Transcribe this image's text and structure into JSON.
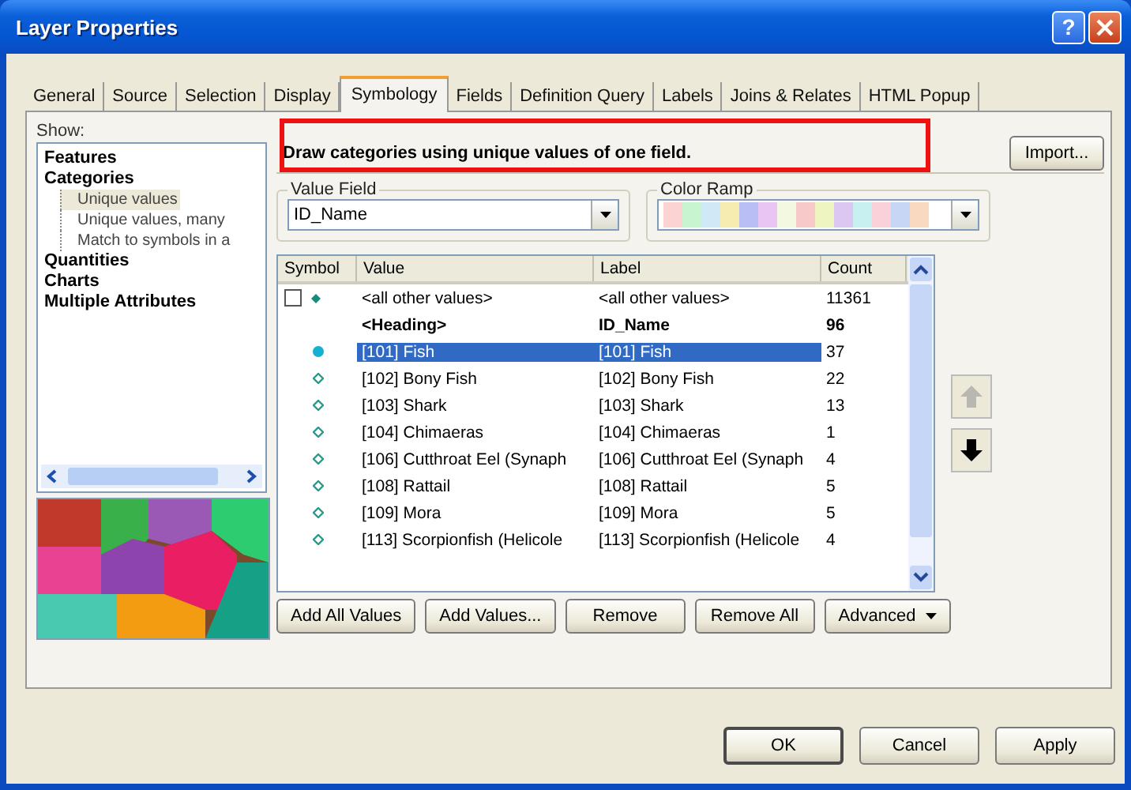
{
  "window": {
    "title": "Layer Properties",
    "help_button": "?"
  },
  "tabs": [
    {
      "label": "General",
      "selected": false
    },
    {
      "label": "Source",
      "selected": false
    },
    {
      "label": "Selection",
      "selected": false
    },
    {
      "label": "Display",
      "selected": false
    },
    {
      "label": "Symbology",
      "selected": true
    },
    {
      "label": "Fields",
      "selected": false
    },
    {
      "label": "Definition Query",
      "selected": false
    },
    {
      "label": "Labels",
      "selected": false
    },
    {
      "label": "Joins & Relates",
      "selected": false
    },
    {
      "label": "HTML Popup",
      "selected": false
    }
  ],
  "show": {
    "label": "Show:",
    "items": [
      {
        "label": "Features",
        "selected": false
      },
      {
        "label": "Categories",
        "selected": false,
        "children": [
          {
            "label": "Unique values",
            "selected": true
          },
          {
            "label": "Unique values, many",
            "selected": false
          },
          {
            "label": "Match to symbols in a",
            "selected": false
          }
        ]
      },
      {
        "label": "Quantities",
        "selected": false
      },
      {
        "label": "Charts",
        "selected": false
      },
      {
        "label": "Multiple Attributes",
        "selected": false
      }
    ]
  },
  "description": "Draw categories using unique values of one field.",
  "import_button": "Import...",
  "value_field": {
    "label": "Value Field",
    "value": "ID_Name"
  },
  "color_ramp": {
    "label": "Color Ramp"
  },
  "table": {
    "columns": [
      "Symbol",
      "Value",
      "Label",
      "Count"
    ],
    "rows": [
      {
        "kind": "other",
        "checked": false,
        "value": "<all other values>",
        "label": "<all other values>",
        "count": "11361"
      },
      {
        "kind": "heading",
        "value": "<Heading>",
        "label": "ID_Name",
        "count": "96"
      },
      {
        "kind": "class",
        "selected": true,
        "value": "[101] Fish",
        "label": "[101] Fish",
        "count": "37"
      },
      {
        "kind": "class",
        "selected": false,
        "value": "[102] Bony Fish",
        "label": "[102] Bony Fish",
        "count": "22"
      },
      {
        "kind": "class",
        "selected": false,
        "value": "[103] Shark",
        "label": "[103] Shark",
        "count": "13"
      },
      {
        "kind": "class",
        "selected": false,
        "value": "[104] Chimaeras",
        "label": "[104] Chimaeras",
        "count": "1"
      },
      {
        "kind": "class",
        "selected": false,
        "value": "[106] Cutthroat Eel (Synaph",
        "label": "[106] Cutthroat Eel (Synaph",
        "count": "4"
      },
      {
        "kind": "class",
        "selected": false,
        "value": "[108] Rattail",
        "label": "[108] Rattail",
        "count": "5"
      },
      {
        "kind": "class",
        "selected": false,
        "value": "[109] Mora",
        "label": "[109] Mora",
        "count": "5"
      },
      {
        "kind": "class",
        "selected": false,
        "value": "[113] Scorpionfish (Helicole",
        "label": "[113] Scorpionfish (Helicole",
        "count": "4"
      }
    ]
  },
  "list_buttons": [
    {
      "label": "Add All Values",
      "kind": "plain"
    },
    {
      "label": "Add Values...",
      "kind": "plain"
    },
    {
      "label": "Remove",
      "kind": "plain"
    },
    {
      "label": "Remove All",
      "kind": "plain"
    },
    {
      "label": "Advanced",
      "kind": "menu"
    }
  ],
  "dialog_buttons": [
    {
      "label": "OK",
      "default": true
    },
    {
      "label": "Cancel",
      "default": false
    },
    {
      "label": "Apply",
      "default": false
    }
  ]
}
